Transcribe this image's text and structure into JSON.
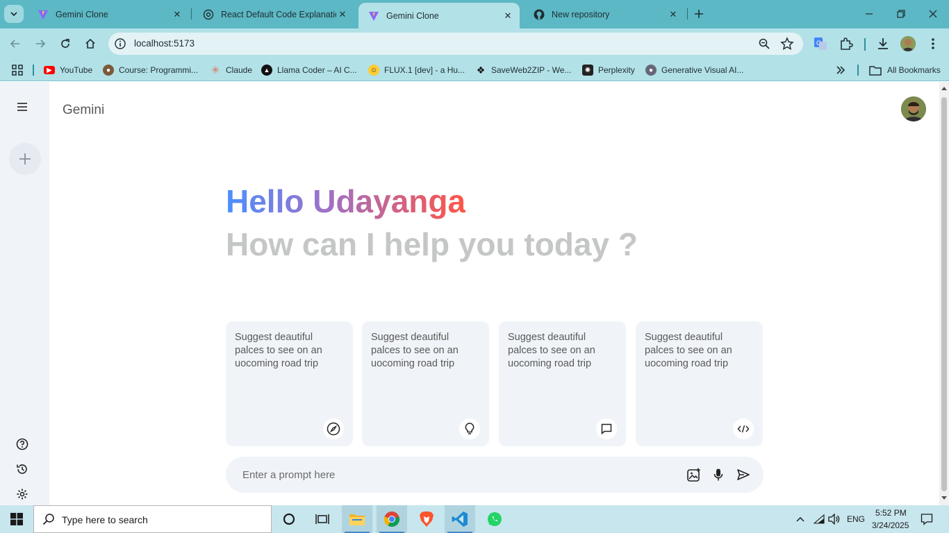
{
  "browser": {
    "tabs": [
      {
        "title": "Gemini Clone",
        "active": false
      },
      {
        "title": "React Default Code Explanation",
        "active": false
      },
      {
        "title": "Gemini Clone",
        "active": true
      },
      {
        "title": "New repository",
        "active": false
      }
    ],
    "url": "localhost:5173",
    "bookmarks": [
      {
        "label": "YouTube",
        "icon": "youtube-icon",
        "color": "#ff0000"
      },
      {
        "label": "Course: Programmi...",
        "icon": "course-icon",
        "color": "#7a5a3a"
      },
      {
        "label": "Claude",
        "icon": "claude-icon",
        "color": "#d97757"
      },
      {
        "label": "Llama Coder – AI C...",
        "icon": "llama-icon",
        "color": "#111111"
      },
      {
        "label": "FLUX.1 [dev] - a Hu...",
        "icon": "huggingface-icon",
        "color": "#ffcc33"
      },
      {
        "label": "SaveWeb2ZIP - We...",
        "icon": "saveweb-icon",
        "color": "#111111"
      },
      {
        "label": "Perplexity",
        "icon": "perplexity-icon",
        "color": "#222222"
      },
      {
        "label": "Generative Visual AI...",
        "icon": "generative-icon",
        "color": "#555555"
      }
    ],
    "all_bookmarks": "All Bookmarks"
  },
  "app": {
    "brand": "Gemini",
    "greeting": "Hello Udayanga",
    "subgreeting": "How can I help you today ?",
    "cards": [
      {
        "text": "Suggest deautiful palces to see on an uocoming road trip",
        "icon": "compass-icon"
      },
      {
        "text": "Suggest deautiful palces to see on an uocoming road trip",
        "icon": "bulb-icon"
      },
      {
        "text": "Suggest deautiful palces to see on an uocoming road trip",
        "icon": "message-icon"
      },
      {
        "text": "Suggest deautiful palces to see on an uocoming road trip",
        "icon": "code-icon"
      }
    ],
    "prompt": {
      "placeholder": "Enter a prompt here",
      "value": ""
    },
    "colors": {
      "gradient_start": "#4b90ff",
      "gradient_end": "#ff5546",
      "card_bg": "#f0f4f9",
      "sidebar_bg": "#f0f4f9"
    }
  },
  "taskbar": {
    "search_placeholder": "Type here to search",
    "language": "ENG",
    "time": "5:52 PM",
    "date": "3/24/2025"
  }
}
